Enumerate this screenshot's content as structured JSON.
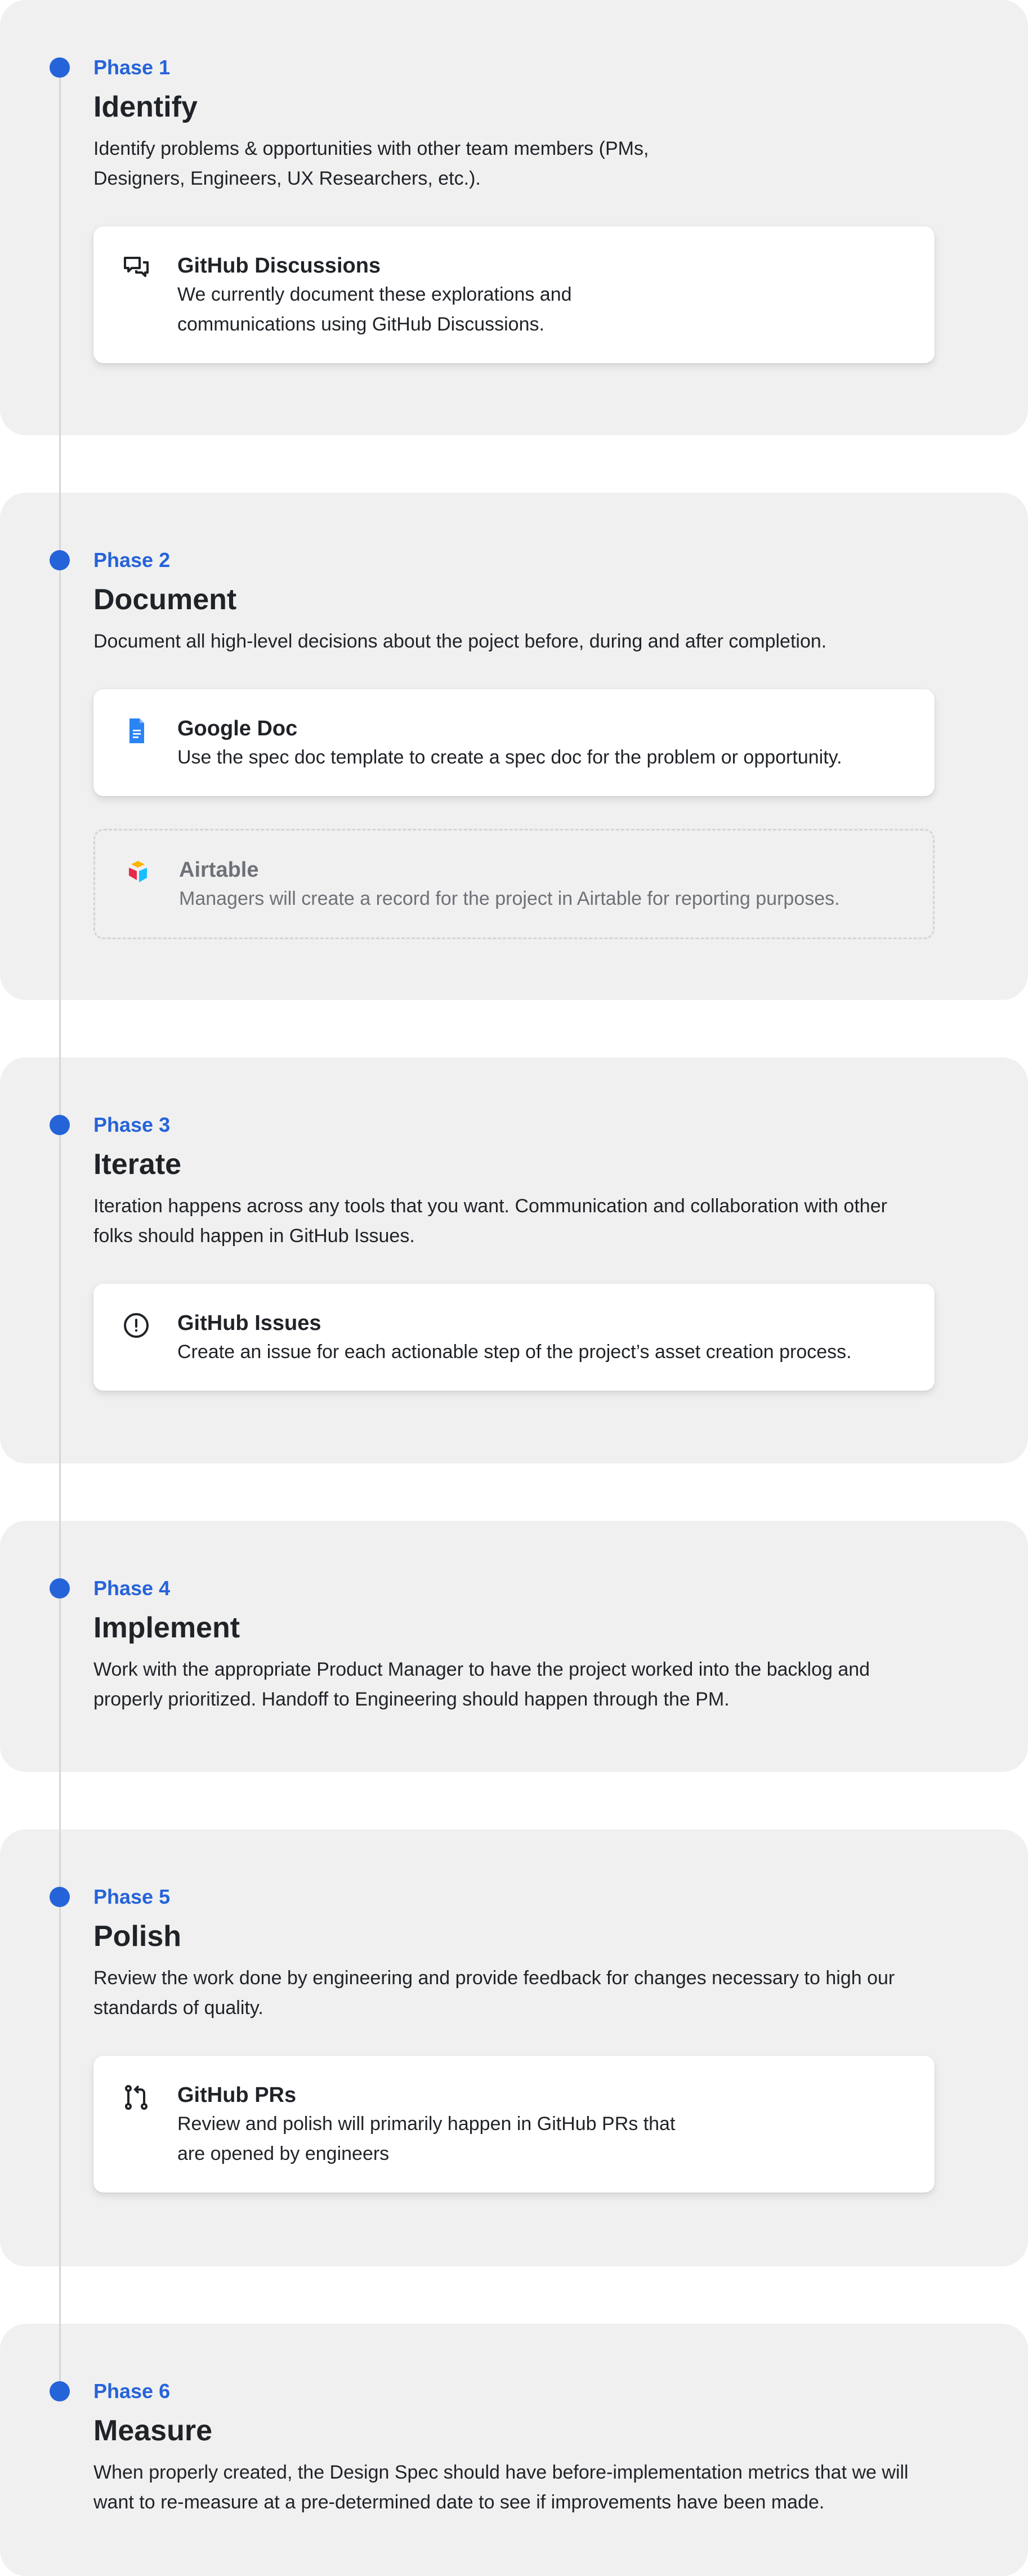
{
  "colors": {
    "accent": "#2563d9",
    "section_bg": "#f0f0f0",
    "text": "#1f2328"
  },
  "phases": [
    {
      "label": "Phase 1",
      "title": "Identify",
      "description": "Identify problems & opportunities with other team members (PMs, Designers, Engineers, UX Researchers, etc.).",
      "cards": [
        {
          "icon": "comment-discussion-icon",
          "title": "GitHub Discussions",
          "description": "We currently document these explorations and communications using GitHub Discussions."
        }
      ]
    },
    {
      "label": "Phase 2",
      "title": "Document",
      "description": "Document all high-level decisions about the poject before, during and after completion.",
      "cards": [
        {
          "icon": "google-doc-icon",
          "title": "Google Doc",
          "description": "Use the spec doc template to create a spec doc for the problem or opportunity."
        },
        {
          "icon": "airtable-icon",
          "title": "Airtable",
          "description": "Managers will create a record for the project in Airtable for reporting purposes."
        }
      ]
    },
    {
      "label": "Phase 3",
      "title": "Iterate",
      "description": "Iteration happens across any tools that you want. Communication and collaboration with other folks should happen in GitHub Issues.",
      "cards": [
        {
          "icon": "issue-icon",
          "title": "GitHub Issues",
          "description": "Create an issue for each actionable step of the project’s asset creation process."
        }
      ]
    },
    {
      "label": "Phase 4",
      "title": "Implement",
      "description": "Work with the appropriate Product Manager to have the project worked into the backlog and properly prioritized. Handoff to Engineering should happen through the PM.",
      "cards": []
    },
    {
      "label": "Phase 5",
      "title": "Polish",
      "description": "Review the work done by engineering and provide feedback for changes necessary to high our standards of quality.",
      "cards": [
        {
          "icon": "pull-request-icon",
          "title": "GitHub PRs",
          "description": "Review and polish will primarily happen in GitHub PRs that are opened by engineers"
        }
      ]
    },
    {
      "label": "Phase 6",
      "title": "Measure",
      "description": "When properly created, the Design Spec should have before-implementation metrics that we will want to re-measure at a pre-determined date to see if improvements have been made.",
      "cards": []
    }
  ]
}
